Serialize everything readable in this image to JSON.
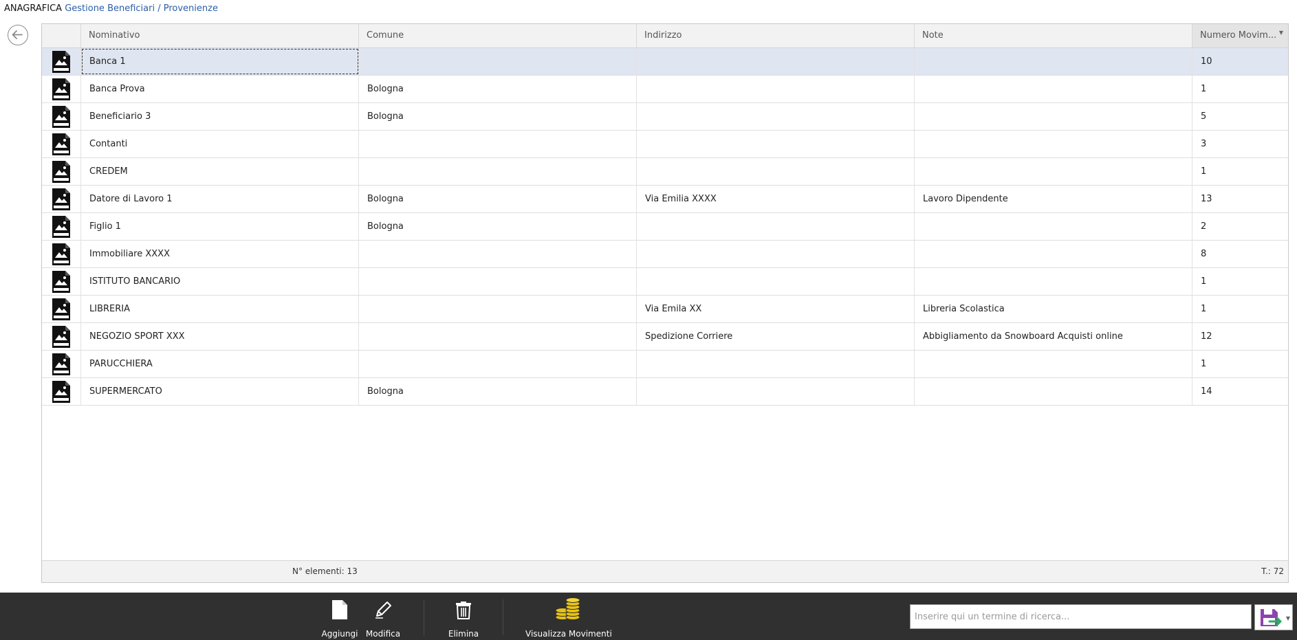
{
  "breadcrumb": {
    "root": "ANAGRAFICA",
    "trail": "Gestione Beneficiari / Provenienze"
  },
  "icons": {
    "back": "arrow-left-icon",
    "row_image": "no-image-icon",
    "sort": "sort-desc-icon"
  },
  "table": {
    "columns": [
      "Nominativo",
      "Comune",
      "Indirizzo",
      "Note",
      "Numero Movim..."
    ],
    "rows": [
      {
        "nominativo": "Banca 1",
        "comune": "",
        "indirizzo": "",
        "note": "",
        "numero": "10"
      },
      {
        "nominativo": "Banca Prova",
        "comune": "Bologna",
        "indirizzo": "",
        "note": "",
        "numero": "1"
      },
      {
        "nominativo": "Beneficiario 3",
        "comune": "Bologna",
        "indirizzo": "",
        "note": "",
        "numero": "5"
      },
      {
        "nominativo": "Contanti",
        "comune": "",
        "indirizzo": "",
        "note": "",
        "numero": "3"
      },
      {
        "nominativo": "CREDEM",
        "comune": "",
        "indirizzo": "",
        "note": "",
        "numero": "1"
      },
      {
        "nominativo": "Datore di Lavoro 1",
        "comune": "Bologna",
        "indirizzo": "Via Emilia XXXX",
        "note": "Lavoro Dipendente",
        "numero": "13"
      },
      {
        "nominativo": "Figlio 1",
        "comune": "Bologna",
        "indirizzo": "",
        "note": "",
        "numero": "2"
      },
      {
        "nominativo": "Immobiliare XXXX",
        "comune": "",
        "indirizzo": "",
        "note": "",
        "numero": "8"
      },
      {
        "nominativo": "ISTITUTO BANCARIO",
        "comune": "",
        "indirizzo": "",
        "note": "",
        "numero": "1"
      },
      {
        "nominativo": "LIBRERIA",
        "comune": "",
        "indirizzo": "Via Emila XX",
        "note": "Libreria Scolastica",
        "numero": "1"
      },
      {
        "nominativo": "NEGOZIO SPORT XXX",
        "comune": "",
        "indirizzo": "Spedizione Corriere",
        "note": "Abbigliamento da Snowboard Acquisti online",
        "numero": "12"
      },
      {
        "nominativo": "PARUCCHIERA",
        "comune": "",
        "indirizzo": "",
        "note": "",
        "numero": "1"
      },
      {
        "nominativo": "SUPERMERCATO",
        "comune": "Bologna",
        "indirizzo": "",
        "note": "",
        "numero": "14"
      }
    ],
    "footer": {
      "count": "N° elementi: 13",
      "total": "T.: 72"
    }
  },
  "toolbar": {
    "buttons": [
      {
        "label": "Aggiungi",
        "icon": "new-document-icon"
      },
      {
        "label": "Modifica",
        "icon": "pencil-icon"
      },
      {
        "label": "Elimina",
        "icon": "trash-icon"
      },
      {
        "label": "Visualizza Movimenti",
        "icon": "coins-icon"
      }
    ]
  },
  "search": {
    "placeholder": "Inserire qui un termine di ricerca...",
    "value": ""
  },
  "save": {
    "icon": "save-icon"
  },
  "colors": {
    "link": "#2b5ea7",
    "selected_row": "#dfe5f1",
    "toolbar_bg": "#303030",
    "coins": "#e8c312",
    "save_icon": "#8e44ad"
  }
}
